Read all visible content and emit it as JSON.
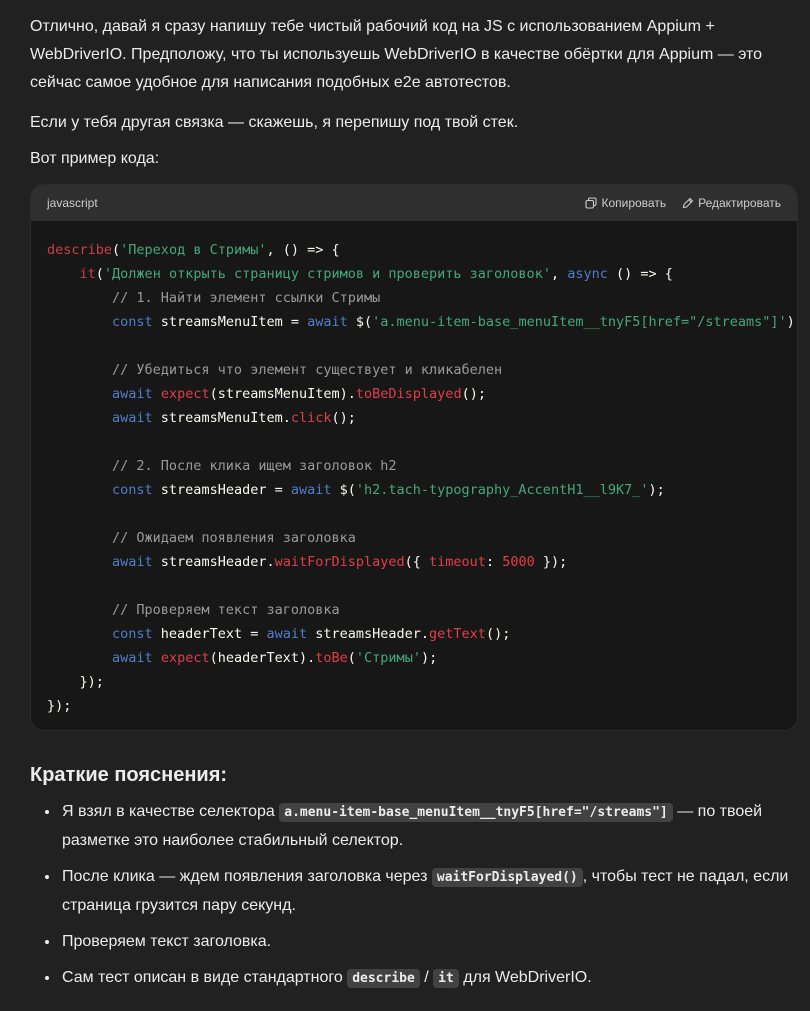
{
  "intro": {
    "p1": "Отлично, давай я сразу напишу тебе чистый рабочий код на JS с использованием Appium + WebDriverIO. Предположу, что ты используешь WebDriverIO в качестве обёртки для Appium — это сейчас самое удобное для написания подобных e2e автотестов.",
    "p2": "Если у тебя другая связка — скажешь, я перепишу под твой стек.",
    "p3": "Вот пример кода:"
  },
  "codeblock": {
    "language": "javascript",
    "copy_label": "Копировать",
    "edit_label": "Редактировать",
    "lines": [
      [
        [
          "k",
          "describe"
        ],
        [
          "p",
          "("
        ],
        [
          "s",
          "'Переход в Стримы'"
        ],
        [
          "p",
          ", () => {"
        ]
      ],
      [
        [
          "p",
          "    "
        ],
        [
          "k",
          "it"
        ],
        [
          "p",
          "("
        ],
        [
          "s",
          "'Должен открыть страницу стримов и проверить заголовок'"
        ],
        [
          "p",
          ", "
        ],
        [
          "kb",
          "async"
        ],
        [
          "p",
          " () => {"
        ]
      ],
      [
        [
          "c",
          "        // 1. Найти элемент ссылки Стримы"
        ]
      ],
      [
        [
          "p",
          "        "
        ],
        [
          "kb",
          "const"
        ],
        [
          "p",
          " streamsMenuItem = "
        ],
        [
          "kb",
          "await"
        ],
        [
          "p",
          " $("
        ],
        [
          "s",
          "'a.menu-item-base_menuItem__tnyF5[href=\"/streams\"]'"
        ],
        [
          "p",
          ");"
        ]
      ],
      [],
      [
        [
          "c",
          "        // Убедиться что элемент существует и кликабелен"
        ]
      ],
      [
        [
          "p",
          "        "
        ],
        [
          "kb",
          "await"
        ],
        [
          "p",
          " "
        ],
        [
          "fn",
          "expect"
        ],
        [
          "p",
          "(streamsMenuItem)."
        ],
        [
          "fn",
          "toBeDisplayed"
        ],
        [
          "p",
          "();"
        ]
      ],
      [
        [
          "p",
          "        "
        ],
        [
          "kb",
          "await"
        ],
        [
          "p",
          " streamsMenuItem."
        ],
        [
          "fn",
          "click"
        ],
        [
          "p",
          "();"
        ]
      ],
      [],
      [
        [
          "c",
          "        // 2. После клика ищем заголовок h2"
        ]
      ],
      [
        [
          "p",
          "        "
        ],
        [
          "kb",
          "const"
        ],
        [
          "p",
          " streamsHeader = "
        ],
        [
          "kb",
          "await"
        ],
        [
          "p",
          " $("
        ],
        [
          "s",
          "'h2.tach-typography_AccentH1__l9K7_'"
        ],
        [
          "p",
          ");"
        ]
      ],
      [],
      [
        [
          "c",
          "        // Ожидаем появления заголовка"
        ]
      ],
      [
        [
          "p",
          "        "
        ],
        [
          "kb",
          "await"
        ],
        [
          "p",
          " streamsHeader."
        ],
        [
          "fn",
          "waitForDisplayed"
        ],
        [
          "p",
          "({ "
        ],
        [
          "fn",
          "timeout"
        ],
        [
          "p",
          ": "
        ],
        [
          "num",
          "5000"
        ],
        [
          "p",
          " });"
        ]
      ],
      [],
      [
        [
          "c",
          "        // Проверяем текст заголовка"
        ]
      ],
      [
        [
          "p",
          "        "
        ],
        [
          "kb",
          "const"
        ],
        [
          "p",
          " headerText = "
        ],
        [
          "kb",
          "await"
        ],
        [
          "p",
          " streamsHeader."
        ],
        [
          "fn",
          "getText"
        ],
        [
          "p",
          "();"
        ]
      ],
      [
        [
          "p",
          "        "
        ],
        [
          "kb",
          "await"
        ],
        [
          "p",
          " "
        ],
        [
          "fn",
          "expect"
        ],
        [
          "p",
          "(headerText)."
        ],
        [
          "fn",
          "toBe"
        ],
        [
          "p",
          "("
        ],
        [
          "s",
          "'Стримы'"
        ],
        [
          "p",
          ");"
        ]
      ],
      [
        [
          "p",
          "    });"
        ]
      ],
      [
        [
          "p",
          "});"
        ]
      ]
    ]
  },
  "summary": {
    "heading": "Краткие пояснения:",
    "items": [
      {
        "parts": [
          [
            "t",
            "Я взял в качестве селектора "
          ],
          [
            "code",
            "a.menu-item-base_menuItem__tnyF5[href=\"/streams\"]"
          ],
          [
            "t",
            " — по твоей разметке это наиболее стабильный селектор."
          ]
        ]
      },
      {
        "parts": [
          [
            "t",
            "После клика — ждем появления заголовка через "
          ],
          [
            "code",
            "waitForDisplayed()"
          ],
          [
            "t",
            ", чтобы тест не падал, если страница грузится пару секунд."
          ]
        ]
      },
      {
        "parts": [
          [
            "t",
            "Проверяем текст заголовка."
          ]
        ]
      },
      {
        "parts": [
          [
            "t",
            "Сам тест описан в виде стандартного "
          ],
          [
            "code",
            "describe"
          ],
          [
            "t",
            " / "
          ],
          [
            "code",
            "it"
          ],
          [
            "t",
            " для WebDriverIO."
          ]
        ]
      }
    ]
  },
  "colors": {
    "background": "#212121",
    "code_background": "#171717",
    "code_header": "#2f2f2f",
    "keyword_red": "#cd3f45",
    "string_green": "#47a77b",
    "keyword_blue": "#4f7ec9",
    "comment_gray": "#9a9a9a"
  },
  "icons": [
    "copy-icon",
    "edit-icon"
  ]
}
